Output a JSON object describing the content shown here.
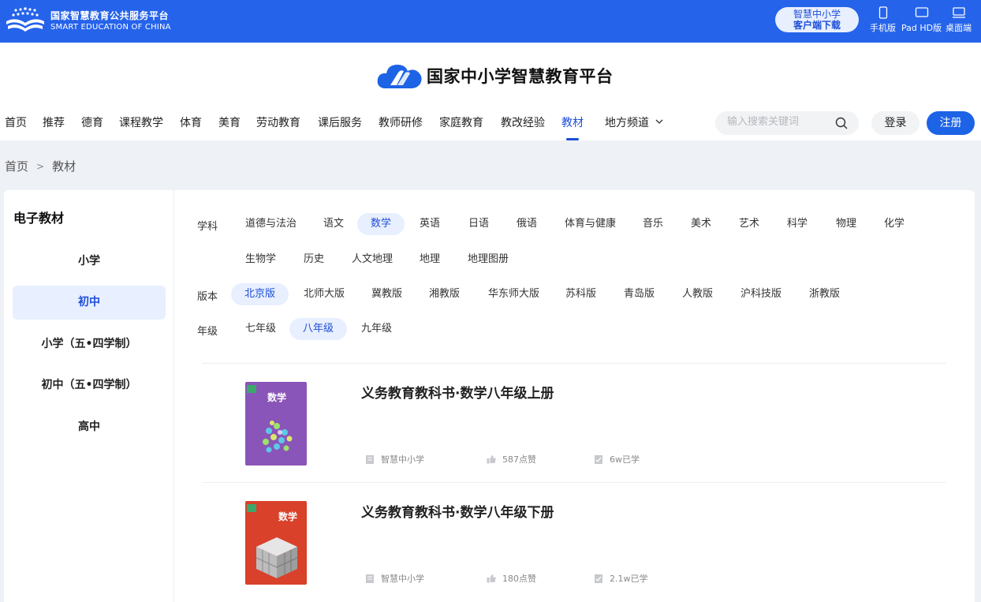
{
  "topbar": {
    "brand_cn": "国家智慧教育公共服务平台",
    "brand_en": "SMART EDUCATION OF CHINA",
    "download_line1": "智慧中小学",
    "download_line2": "客户端下载",
    "devices": [
      {
        "label": "手机版",
        "icon": "phone-icon"
      },
      {
        "label": "Pad HD版",
        "icon": "tablet-icon"
      },
      {
        "label": "桌面端",
        "icon": "desktop-icon"
      }
    ]
  },
  "header": {
    "logo_text": "国家中小学智慧教育平台",
    "nav": [
      "首页",
      "推荐",
      "德育",
      "课程教学",
      "体育",
      "美育",
      "劳动教育",
      "课后服务",
      "教师研修",
      "家庭教育",
      "教改经验",
      "教材",
      "地方频道"
    ],
    "active_nav": "教材",
    "search_placeholder": "输入搜索关键词",
    "login_label": "登录",
    "register_label": "注册"
  },
  "breadcrumb": {
    "home": "首页",
    "separator": ">",
    "current": "教材"
  },
  "sidebar": {
    "title": "电子教材",
    "items": [
      "小学",
      "初中",
      "小学（五•四学制）",
      "初中（五•四学制）",
      "高中"
    ],
    "active": "初中"
  },
  "filters": {
    "subject": {
      "label": "学科",
      "options": [
        "道德与法治",
        "语文",
        "数学",
        "英语",
        "日语",
        "俄语",
        "体育与健康",
        "音乐",
        "美术",
        "艺术",
        "科学",
        "物理",
        "化学",
        "生物学",
        "历史",
        "人文地理",
        "地理",
        "地理图册"
      ],
      "active": "数学"
    },
    "edition": {
      "label": "版本",
      "options": [
        "北京版",
        "北师大版",
        "冀教版",
        "湘教版",
        "华东师大版",
        "苏科版",
        "青岛版",
        "人教版",
        "沪科技版",
        "浙教版"
      ],
      "active": "北京版"
    },
    "grade": {
      "label": "年级",
      "options": [
        "七年级",
        "八年级",
        "九年级"
      ],
      "active": "八年级"
    }
  },
  "books": [
    {
      "title": "义务教育教科书·数学八年级上册",
      "publisher": "智慧中小学",
      "likes": "587点赞",
      "learners": "6w已学",
      "cover_color": "#8a55b8",
      "cover_subject": "数学"
    },
    {
      "title": "义务教育教科书·数学八年级下册",
      "publisher": "智慧中小学",
      "likes": "180点赞",
      "learners": "2.1w已学",
      "cover_color": "#d9412b",
      "cover_subject": "数学"
    }
  ],
  "colors": {
    "topbar": "#2563eb",
    "accent": "#1d4ed8",
    "chip_active_bg": "#e8efff"
  }
}
